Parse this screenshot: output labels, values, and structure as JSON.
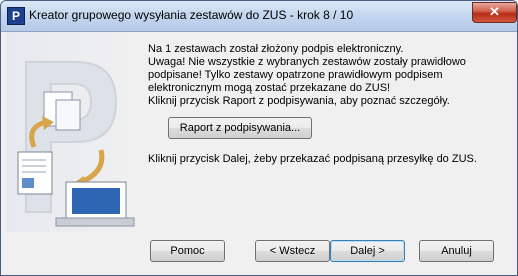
{
  "window": {
    "title": "Kreator grupowego wysyłania zestawów do ZUS - krok 8 / 10",
    "app_icon": "P",
    "close_glyph": "✕"
  },
  "message": {
    "line1": "Na 1 zestawach został złożony podpis elektroniczny.",
    "line2": "Uwaga! Nie wszystkie z wybranych zestawów zostały prawidłowo podpisane! Tylko zestawy opatrzone prawidłowym podpisem elektronicznym mogą zostać przekazane do ZUS!",
    "line3": "Kliknij przycisk Raport z podpisywania, aby poznać szczegóły.",
    "next_info": "Kliknij przycisk Dalej, żeby przekazać podpisaną przesyłkę do ZUS."
  },
  "report_button": {
    "label": "Raport z podpisywania..."
  },
  "buttons": {
    "help": "Pomoc",
    "back": "< Wstecz",
    "next": "Dalej >",
    "cancel": "Anuluj"
  },
  "colors": {
    "title_bg": "#c3d6ee",
    "close_red": "#c8412a",
    "dialog_bg": "#f0f0f0"
  }
}
